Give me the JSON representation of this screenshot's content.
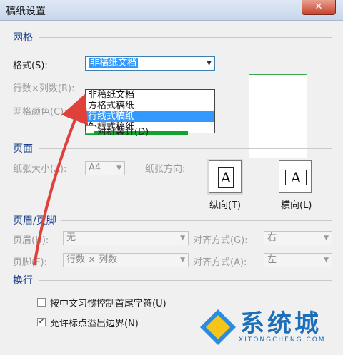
{
  "window": {
    "title": "稿纸设置",
    "close_label": "✕"
  },
  "grid": {
    "header": "网格",
    "format_label": "格式(S):",
    "format_value": "非稿纸文档",
    "dropdown_options": [
      "非稿纸文档",
      "方格式稿纸",
      "行线式稿纸",
      "外框式稿纸"
    ],
    "highlighted_option_index": 2,
    "rows_cols_label": "行数×列数(R):",
    "grid_color_label": "网格颜色(C):",
    "fold_binding_label": "对折装订(D)",
    "grid_color": "#11a22f"
  },
  "page": {
    "header": "页面",
    "paper_size_label": "纸张大小(Z):",
    "paper_size_value": "A4",
    "orientation_label": "纸张方向:",
    "portrait_label": "纵向(T)",
    "landscape_label": "横向(L)",
    "glyph": "A"
  },
  "header_footer": {
    "header": "页眉/页脚",
    "header_label": "页眉(H):",
    "header_value": "无",
    "header_align_label": "对齐方式(G):",
    "header_align_value": "右",
    "footer_label": "页脚(F):",
    "footer_value": "行数 × 列数",
    "footer_align_label": "对齐方式(A):",
    "footer_align_value": "左"
  },
  "line_break": {
    "header": "换行",
    "option1_label": "按中文习惯控制首尾字符(U)",
    "option2_label": "允许标点溢出边界(N)",
    "option2_checked": true
  },
  "watermark": {
    "brand": "系统城",
    "url": "XITONGCHENG.COM"
  },
  "colors": {
    "accent": "#3399ff",
    "section_header": "#1a3f8b",
    "preview_border": "#3aa84a",
    "arrow": "#e0403a"
  }
}
